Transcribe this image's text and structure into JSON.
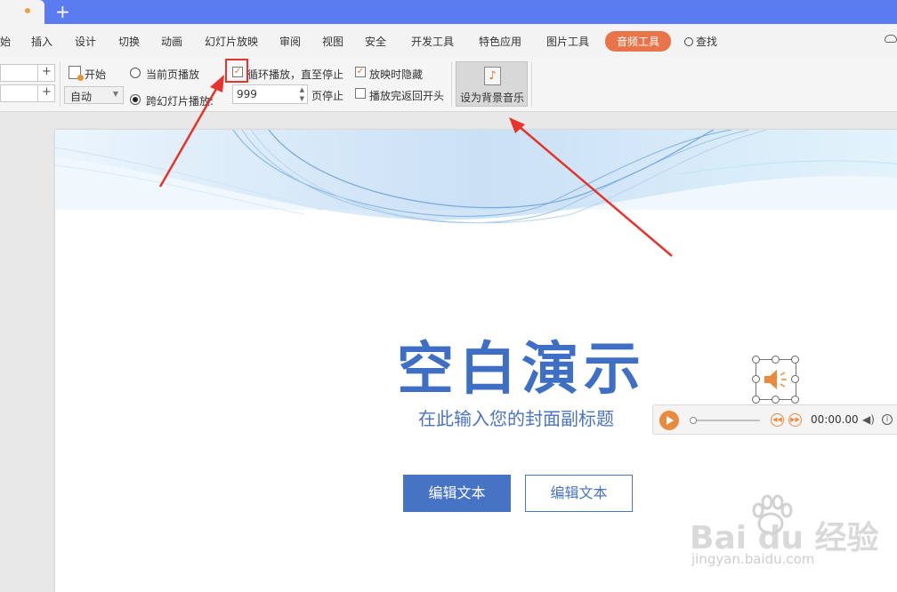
{
  "menu": {
    "items": [
      "始",
      "插入",
      "设计",
      "切换",
      "动画",
      "幻灯片放映",
      "审阅",
      "视图",
      "安全",
      "开发工具",
      "特色应用",
      "图片工具"
    ],
    "active": "音频工具",
    "search": "查找"
  },
  "ribbon": {
    "start_label": "开始",
    "start_select": "自动",
    "current_page": "当前页播放",
    "cross_slides": "跨幻灯片播放:",
    "loop_label": "循环播放，直至停止",
    "slide_count": "999",
    "stop_after": "页停止",
    "hide_on_show": "放映时隐藏",
    "rewind": "播放完返回开头",
    "bgm_label": "设为背景音乐"
  },
  "slide": {
    "title": "空白演示",
    "subtitle": "在此输入您的封面副标题",
    "btn1": "编辑文本",
    "btn2": "编辑文本"
  },
  "player": {
    "time": "00:00.00"
  },
  "watermark": {
    "brand": "Bai du 经验",
    "url": "jingyan.baidu.com"
  },
  "colors": {
    "titlebar": "#5b7cf0",
    "accent": "#e8744a",
    "slide_blue": "#3f6fc4",
    "arrow_red": "#e8322c"
  }
}
